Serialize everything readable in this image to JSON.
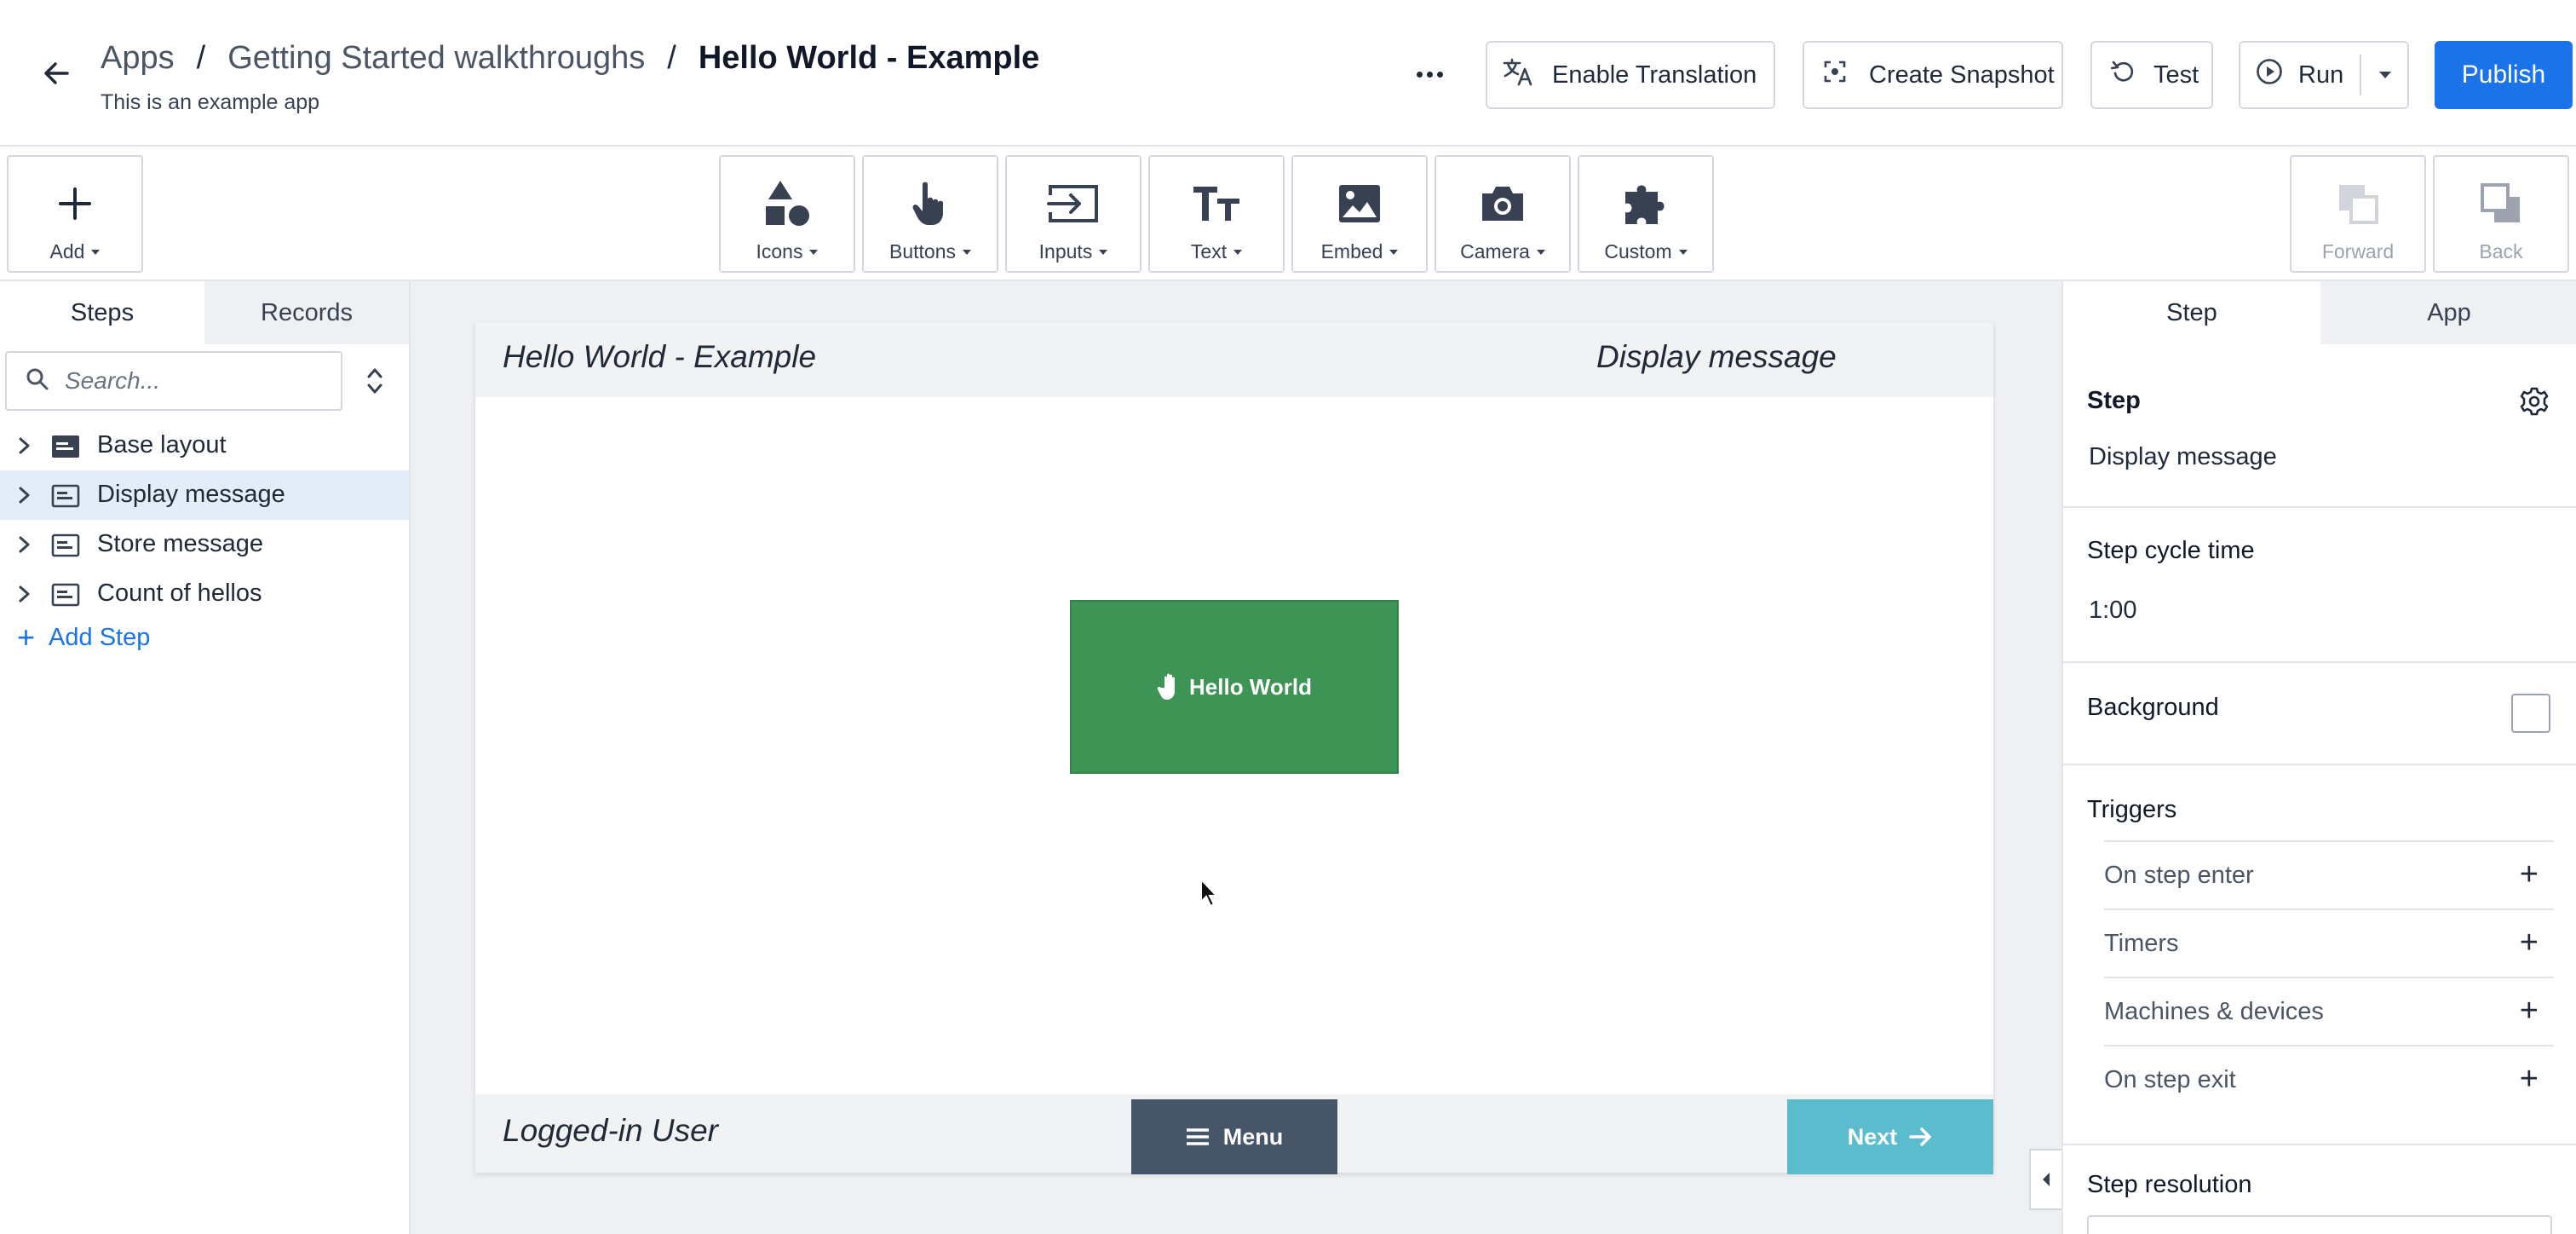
{
  "header": {
    "breadcrumb": [
      "Apps",
      "Getting Started walkthroughs",
      "Hello World - Example"
    ],
    "separator": "/",
    "subtitle": "This is an example app",
    "buttons": {
      "translation": "Enable Translation",
      "snapshot": "Create Snapshot",
      "test": "Test",
      "run": "Run",
      "publish": "Publish"
    },
    "publish_color": "#1a73e8"
  },
  "toolbar": {
    "add": "Add",
    "widgets": [
      {
        "label": "Icons",
        "icon": "shapes-icon"
      },
      {
        "label": "Buttons",
        "icon": "pointer-hand-icon"
      },
      {
        "label": "Inputs",
        "icon": "input-arrow-icon"
      },
      {
        "label": "Text",
        "icon": "text-size-icon"
      },
      {
        "label": "Embed",
        "icon": "image-icon"
      },
      {
        "label": "Camera",
        "icon": "camera-icon"
      },
      {
        "label": "Custom",
        "icon": "puzzle-icon"
      }
    ],
    "forward": "Forward",
    "back": "Back"
  },
  "left_panel": {
    "tabs": [
      "Steps",
      "Records"
    ],
    "active_tab": "Steps",
    "search_placeholder": "Search...",
    "steps": [
      {
        "label": "Base layout",
        "icon": "base-layout-icon",
        "selected": false
      },
      {
        "label": "Display message",
        "icon": "step-icon",
        "selected": true
      },
      {
        "label": "Store message",
        "icon": "step-icon",
        "selected": false
      },
      {
        "label": "Count of hellos",
        "icon": "step-icon",
        "selected": false
      }
    ],
    "add_step": "Add Step"
  },
  "canvas": {
    "app_title": "Hello World - Example",
    "step_title": "Display message",
    "hello_button": "Hello World",
    "hello_button_color": "#3e9455",
    "user_label": "Logged-in User",
    "menu_button": "Menu",
    "menu_color": "#475569",
    "next_button": "Next",
    "next_color": "#5bbccd"
  },
  "right_panel": {
    "tabs": [
      "Step",
      "App"
    ],
    "active_tab": "Step",
    "step_heading": "Step",
    "step_name": "Display message",
    "cycle_time_label": "Step cycle time",
    "cycle_time_value": "1:00",
    "background_label": "Background",
    "triggers_label": "Triggers",
    "triggers": [
      "On step enter",
      "Timers",
      "Machines & devices",
      "On step exit"
    ],
    "resolution_label": "Step resolution"
  }
}
